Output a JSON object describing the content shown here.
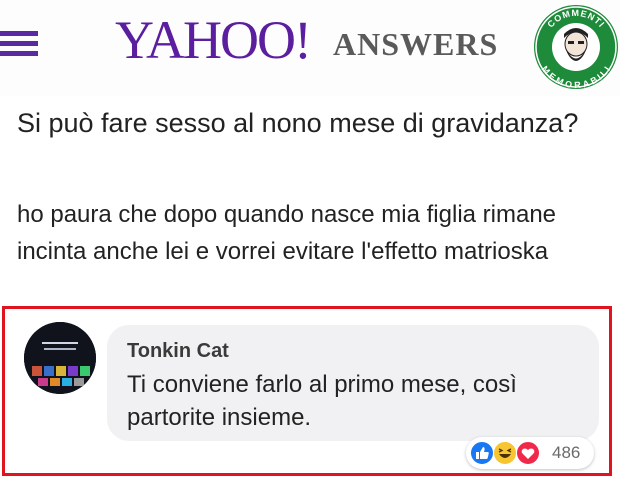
{
  "header": {
    "logo_main": "YAHOO!",
    "logo_sub": "ANSWERS",
    "badge": {
      "top_text": "COMMENTI",
      "bottom_text": "MEMORABILI",
      "color": "#1e8b3a"
    },
    "menu_icon": "hamburger-menu-icon"
  },
  "question": {
    "title": "Si può fare sesso al nono mese di gravidanza?",
    "body": "ho paura che dopo quando nasce mia figlia rimane incinta anche lei e vorrei evitare l'effetto matrioska"
  },
  "comment": {
    "author": "Tonkin Cat",
    "text": "Ti conviene farlo al primo mese, così partorite insieme.",
    "reactions": {
      "icons": [
        "like-icon",
        "haha-icon",
        "love-icon"
      ],
      "count": "486"
    },
    "highlight_color": "#e0141e"
  },
  "colors": {
    "yahoo_purple": "#5b1e9e",
    "like_blue": "#1877f2",
    "haha_yellow": "#f7c531",
    "love_red": "#f0284a"
  }
}
